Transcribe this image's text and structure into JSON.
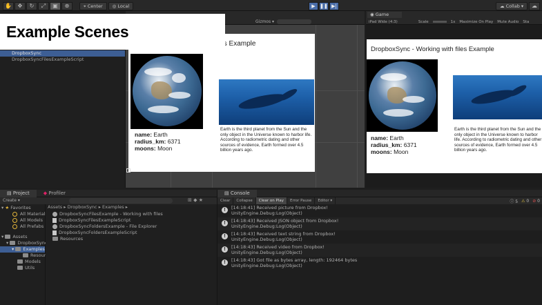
{
  "toolbar": {
    "pivot_label": "Center",
    "space_label": "Local",
    "collab_label": "Collab"
  },
  "title": "Example Scenes",
  "hierarchy": {
    "items": [
      "DropboxSync",
      "DropboxSyncFilesExampleScript"
    ]
  },
  "scene": {
    "gizmos_label": "Gizmos",
    "card_title": "les Example",
    "info": {
      "name_key": "name:",
      "name_val": "Earth",
      "radius_key": "radius_km:",
      "radius_val": "6371",
      "moons_key": "moons:",
      "moons_val": "Moon"
    },
    "description": "Earth is the third planet from the Sun and the only object in the Universe known to harbor life. According to radiometric dating and other sources of evidence, Earth formed over 4.5 billion years ago."
  },
  "game": {
    "tab_label": "Game",
    "resolution_label": "iPad Wide (4:3)",
    "scale_label": "Scale",
    "scale_value": "1x",
    "options": [
      "Maximize On Play",
      "Mute Audio",
      "Sta"
    ],
    "card_title": "DropboxSync - Working with files Example"
  },
  "project": {
    "tabs": [
      "Project",
      "Profiler"
    ],
    "create_label": "Create",
    "favorites": {
      "header": "Favorites",
      "items": [
        "All Materials",
        "All Models",
        "All Prefabs"
      ]
    },
    "assets": {
      "header": "Assets",
      "root": "DropboxSync",
      "selected": "Examples",
      "children": [
        "Resour",
        "Models",
        "Utils"
      ]
    },
    "breadcrumb": [
      "Assets",
      "DropboxSync",
      "Examples"
    ],
    "files": [
      {
        "name": "DropboxSyncFilesExample - Working with files",
        "kind": "scene"
      },
      {
        "name": "DropboxSyncFilesExampleScript",
        "kind": "script"
      },
      {
        "name": "DropboxSyncFoldersExample - File Explorer",
        "kind": "scene"
      },
      {
        "name": "DropboxSyncFoldersExampleScript",
        "kind": "script"
      },
      {
        "name": "Resources",
        "kind": "folder"
      }
    ]
  },
  "console": {
    "tab_label": "Console",
    "buttons": [
      "Clear",
      "Collapse",
      "Clear on Play",
      "Error Pause",
      "Editor"
    ],
    "counts": [
      "5",
      "0",
      "0"
    ],
    "entries": [
      {
        "line1": "[14:18:41] Received picture from Dropbox!",
        "line2": "UnityEngine.Debug:Log(Object)"
      },
      {
        "line1": "[14:18:43] Received JSON object from Dropbox!",
        "line2": "UnityEngine.Debug:Log(Object)"
      },
      {
        "line1": "[14:18:43] Received text string from Dropbox!",
        "line2": "UnityEngine.Debug:Log(Object)"
      },
      {
        "line1": "[14:18:43] Received video from Dropbox!",
        "line2": "UnityEngine.Debug:Log(Object)"
      },
      {
        "line1": "[14:18:43] Got file as bytes array, length: 192464 bytes",
        "line2": "UnityEngine.Debug:Log(Object)"
      }
    ]
  },
  "colors": {
    "play_blue": "#4a6da8",
    "selection": "#3d5e94",
    "favorites_yellow": "#e4b63a"
  }
}
